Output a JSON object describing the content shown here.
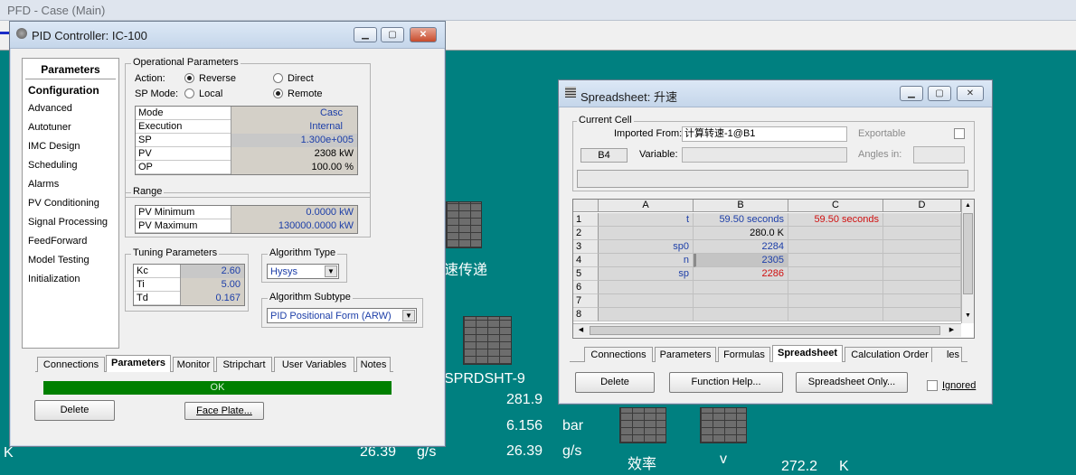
{
  "pfd": {
    "title": "PFD - Case (Main)",
    "labels": {
      "speed_transfer": "速传递",
      "sprdsht9": "SPRDSHT-9",
      "v1": "281.9",
      "v2": "6.156",
      "v2_unit": "bar",
      "v3": "26.39",
      "v3_unit": "g/s",
      "v4": "26.39",
      "v4_unit": "g/s",
      "k_left": "K",
      "efficiency": "效率",
      "v_label": "v",
      "v5": "272.2",
      "v5_unit": "K"
    }
  },
  "pid": {
    "title": "PID Controller: IC-100",
    "nav_header": "Parameters",
    "nav": [
      "Configuration",
      "Advanced",
      "Autotuner",
      "IMC Design",
      "Scheduling",
      "Alarms",
      "PV Conditioning",
      "Signal Processing",
      "FeedForward",
      "Model Testing",
      "Initialization"
    ],
    "op_group": "Operational Parameters",
    "action_label": "Action:",
    "reverse": "Reverse",
    "direct": "Direct",
    "spmode_label": "SP Mode:",
    "local": "Local",
    "remote": "Remote",
    "params": [
      {
        "k": "Mode",
        "v": "Casc"
      },
      {
        "k": "Execution",
        "v": "Internal"
      },
      {
        "k": "SP",
        "v": "1.300e+005"
      },
      {
        "k": "PV",
        "v": "2308 kW"
      },
      {
        "k": "OP",
        "v": "100.00 %"
      }
    ],
    "range_group": "Range",
    "range": [
      {
        "k": "PV Minimum",
        "v": "0.0000 kW"
      },
      {
        "k": "PV Maximum",
        "v": "130000.0000 kW"
      }
    ],
    "tuning_group": "Tuning Parameters",
    "tuning": [
      {
        "k": "Kc",
        "v": "2.60"
      },
      {
        "k": "Ti",
        "v": "5.00"
      },
      {
        "k": "Td",
        "v": "0.167"
      }
    ],
    "algo_type_group": "Algorithm Type",
    "algo_type": "Hysys",
    "algo_subtype_group": "Algorithm Subtype",
    "algo_subtype": "PID Positional Form (ARW)",
    "tabs": [
      "Connections",
      "Parameters",
      "Monitor",
      "Stripchart",
      "User Variables",
      "Notes"
    ],
    "status": "OK",
    "delete": "Delete",
    "faceplate": "Face Plate..."
  },
  "sheet": {
    "title": "Spreadsheet: 升速",
    "current_cell": "Current Cell",
    "imported_label": "Imported From:",
    "imported_value": "计算转速-1@B1",
    "exportable": "Exportable",
    "cell_ref": "B4",
    "variable_label": "Variable:",
    "angles_label": "Angles in:",
    "columns": [
      "A",
      "B",
      "C",
      "D"
    ],
    "rows": [
      {
        "n": "1",
        "a": "t",
        "b": "59.50 seconds",
        "c": "59.50 seconds",
        "d": ""
      },
      {
        "n": "2",
        "a": "",
        "b": "280.0 K",
        "c": "",
        "d": ""
      },
      {
        "n": "3",
        "a": "sp0",
        "b": "2284",
        "c": "",
        "d": ""
      },
      {
        "n": "4",
        "a": "n",
        "b": "2305",
        "c": "",
        "d": ""
      },
      {
        "n": "5",
        "a": "sp",
        "b": "2286",
        "c": "",
        "d": ""
      },
      {
        "n": "6",
        "a": "",
        "b": "",
        "c": "",
        "d": ""
      },
      {
        "n": "7",
        "a": "",
        "b": "",
        "c": "",
        "d": ""
      },
      {
        "n": "8",
        "a": "",
        "b": "",
        "c": "",
        "d": ""
      }
    ],
    "tabs": [
      "Connections",
      "Parameters",
      "Formulas",
      "Spreadsheet",
      "Calculation Order",
      "les"
    ],
    "delete": "Delete",
    "function_help": "Function Help...",
    "spreadsheet_only": "Spreadsheet Only...",
    "ignored": "Ignored"
  },
  "colors": {
    "teal": "#008080",
    "status_green": "#008000",
    "blue_text": "#1c3ea8",
    "red_text": "#d01010"
  }
}
